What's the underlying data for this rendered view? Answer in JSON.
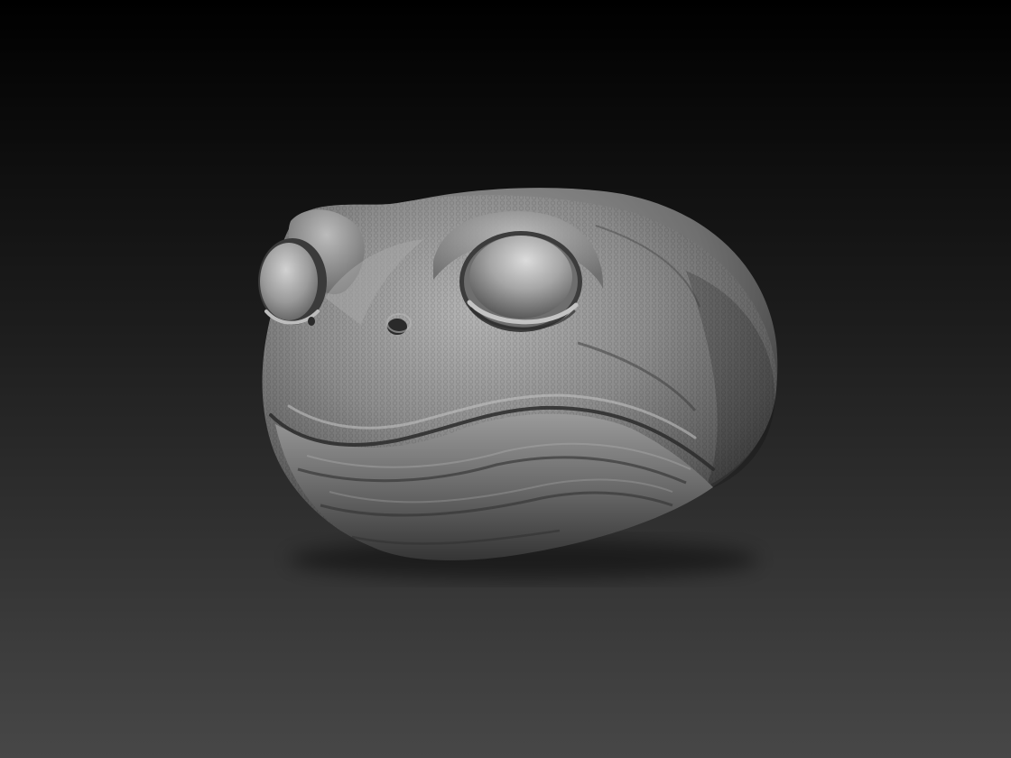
{
  "viewport": {
    "background_top_color": "#000000",
    "background_bottom_color": "#474747",
    "subject": "frog-head-sculpt",
    "material_color": "#8e8e8e"
  }
}
